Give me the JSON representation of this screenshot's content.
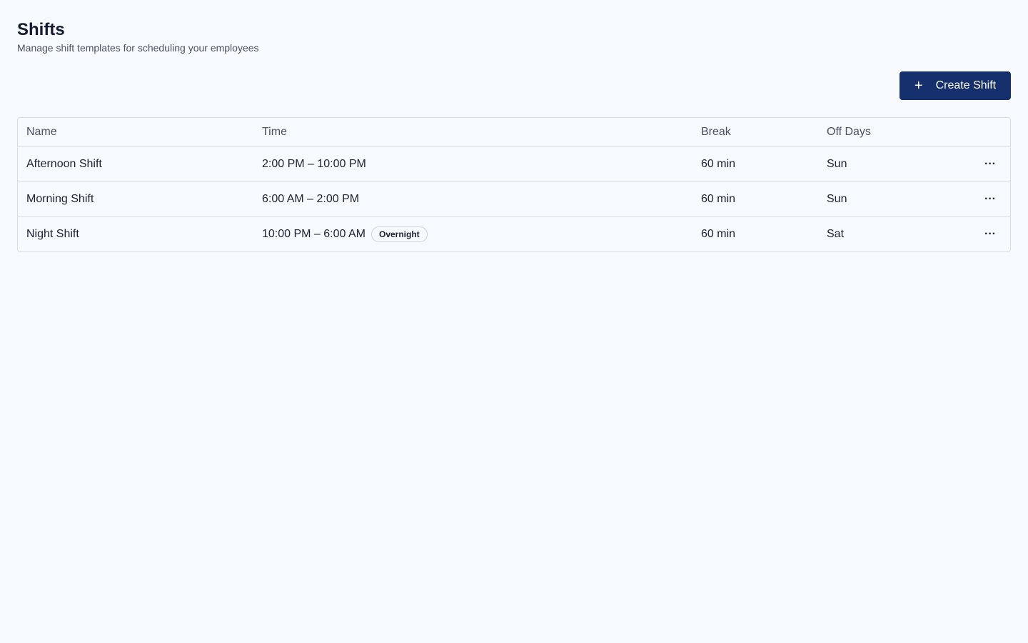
{
  "header": {
    "title": "Shifts",
    "subtitle": "Manage shift templates for scheduling your employees"
  },
  "toolbar": {
    "create_label": "Create Shift",
    "create_icon": "plus-icon"
  },
  "table": {
    "columns": [
      "Name",
      "Time",
      "Break",
      "Off Days"
    ],
    "rows": [
      {
        "name": "Afternoon Shift",
        "time": "2:00 PM – 10:00 PM",
        "badge": "",
        "break": "60 min",
        "off_days": "Sun"
      },
      {
        "name": "Morning Shift",
        "time": "6:00 AM – 2:00 PM",
        "badge": "",
        "break": "60 min",
        "off_days": "Sun"
      },
      {
        "name": "Night Shift",
        "time": "10:00 PM – 6:00 AM",
        "badge": "Overnight",
        "break": "60 min",
        "off_days": "Sat"
      }
    ],
    "actions_icon": "more-horizontal-icon"
  },
  "colors": {
    "background": "#f7fafe",
    "primary": "#15306d",
    "border": "#d8dde6"
  }
}
